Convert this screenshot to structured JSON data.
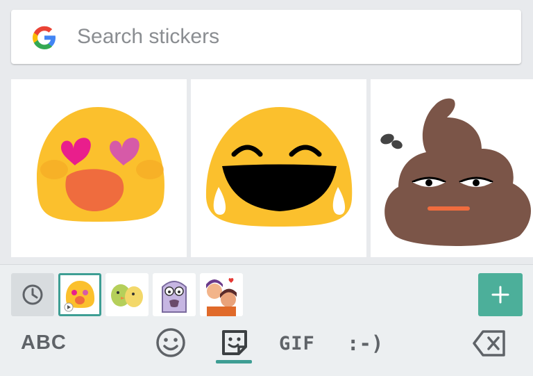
{
  "search": {
    "placeholder": "Search stickers"
  },
  "stickers": [
    {
      "name": "heart-eyes-blob"
    },
    {
      "name": "tears-of-joy-blob"
    },
    {
      "name": "pile-of-poo"
    }
  ],
  "tray": {
    "packs": [
      {
        "name": "blob-emoji-pack",
        "selected": true
      },
      {
        "name": "bird-pack",
        "selected": false
      },
      {
        "name": "monster-pack",
        "selected": false
      },
      {
        "name": "couple-pack",
        "selected": false
      }
    ]
  },
  "keys": {
    "abc_label": "ABC",
    "gif_label": "GIF",
    "emoticon_label": ":-)"
  },
  "colors": {
    "accent": "#3e9e94",
    "add_button": "#4caf9a",
    "blob_yellow": "#fbc02d",
    "poo_brown": "#7b5548"
  }
}
